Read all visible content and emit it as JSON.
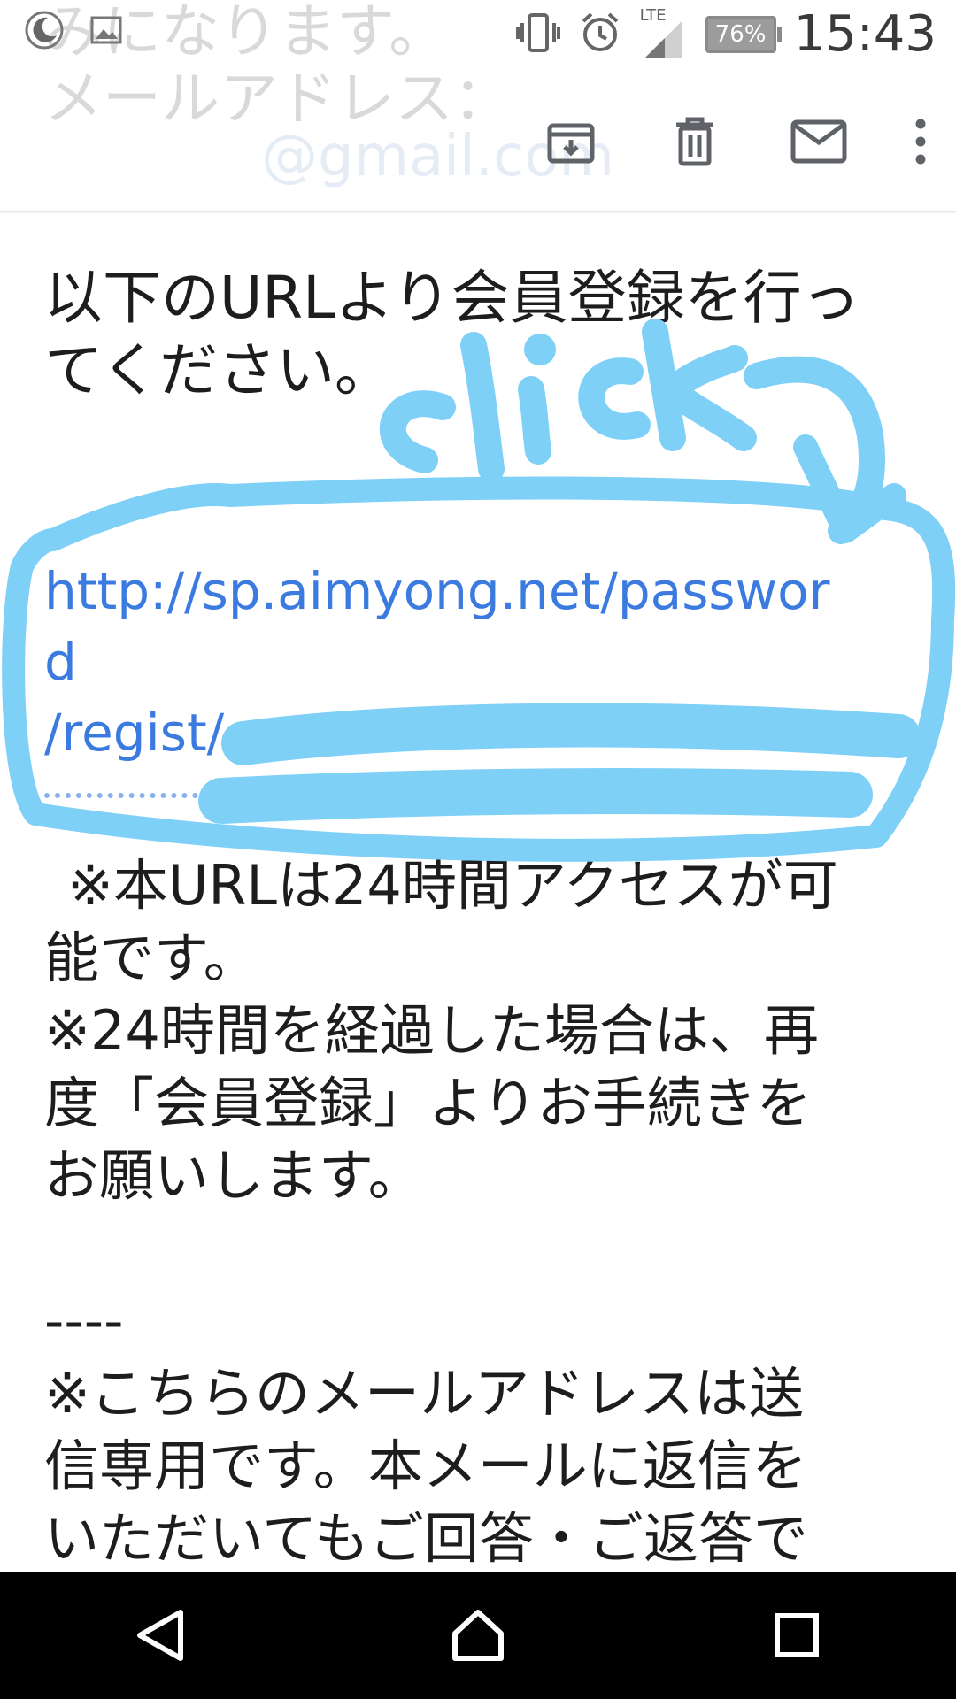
{
  "status_bar": {
    "time": "15:43",
    "battery": "76%",
    "network": "LTE"
  },
  "ghost_text": {
    "line1": "みになります。",
    "line2": "メールアドレス：",
    "email": "@gmail.com"
  },
  "toolbar": {
    "archive_icon": "archive-icon",
    "delete_icon": "trash-icon",
    "mail_icon": "mail-icon",
    "more_icon": "more-vert-icon"
  },
  "body": {
    "intro_line1": "以下のURLより会員登録を行っ",
    "intro_line2": "てください。",
    "url_line1": "http://sp.aimyong.net/passwor",
    "url_line2": "d",
    "url_line3": "/regist/",
    "note1_line1": "※本URLは24時間アクセスが可",
    "note1_line2": "能です。",
    "note2_line1": "※24時間を経過した場合は、再",
    "note2_line2": "度「会員登録」よりお手続きを",
    "note2_line3": "お願いします。",
    "separator": "----",
    "note3_line1": "※こちらのメールアドレスは送",
    "note3_line2": "信専用です。本メールに返信を",
    "note3_line3": "いただいてもご回答・ご返答で"
  },
  "annotation": {
    "text": "click",
    "color": "#7fd0f7"
  },
  "nav": {
    "back_icon": "back-triangle-icon",
    "home_icon": "home-icon",
    "recents_icon": "recents-square-icon"
  }
}
